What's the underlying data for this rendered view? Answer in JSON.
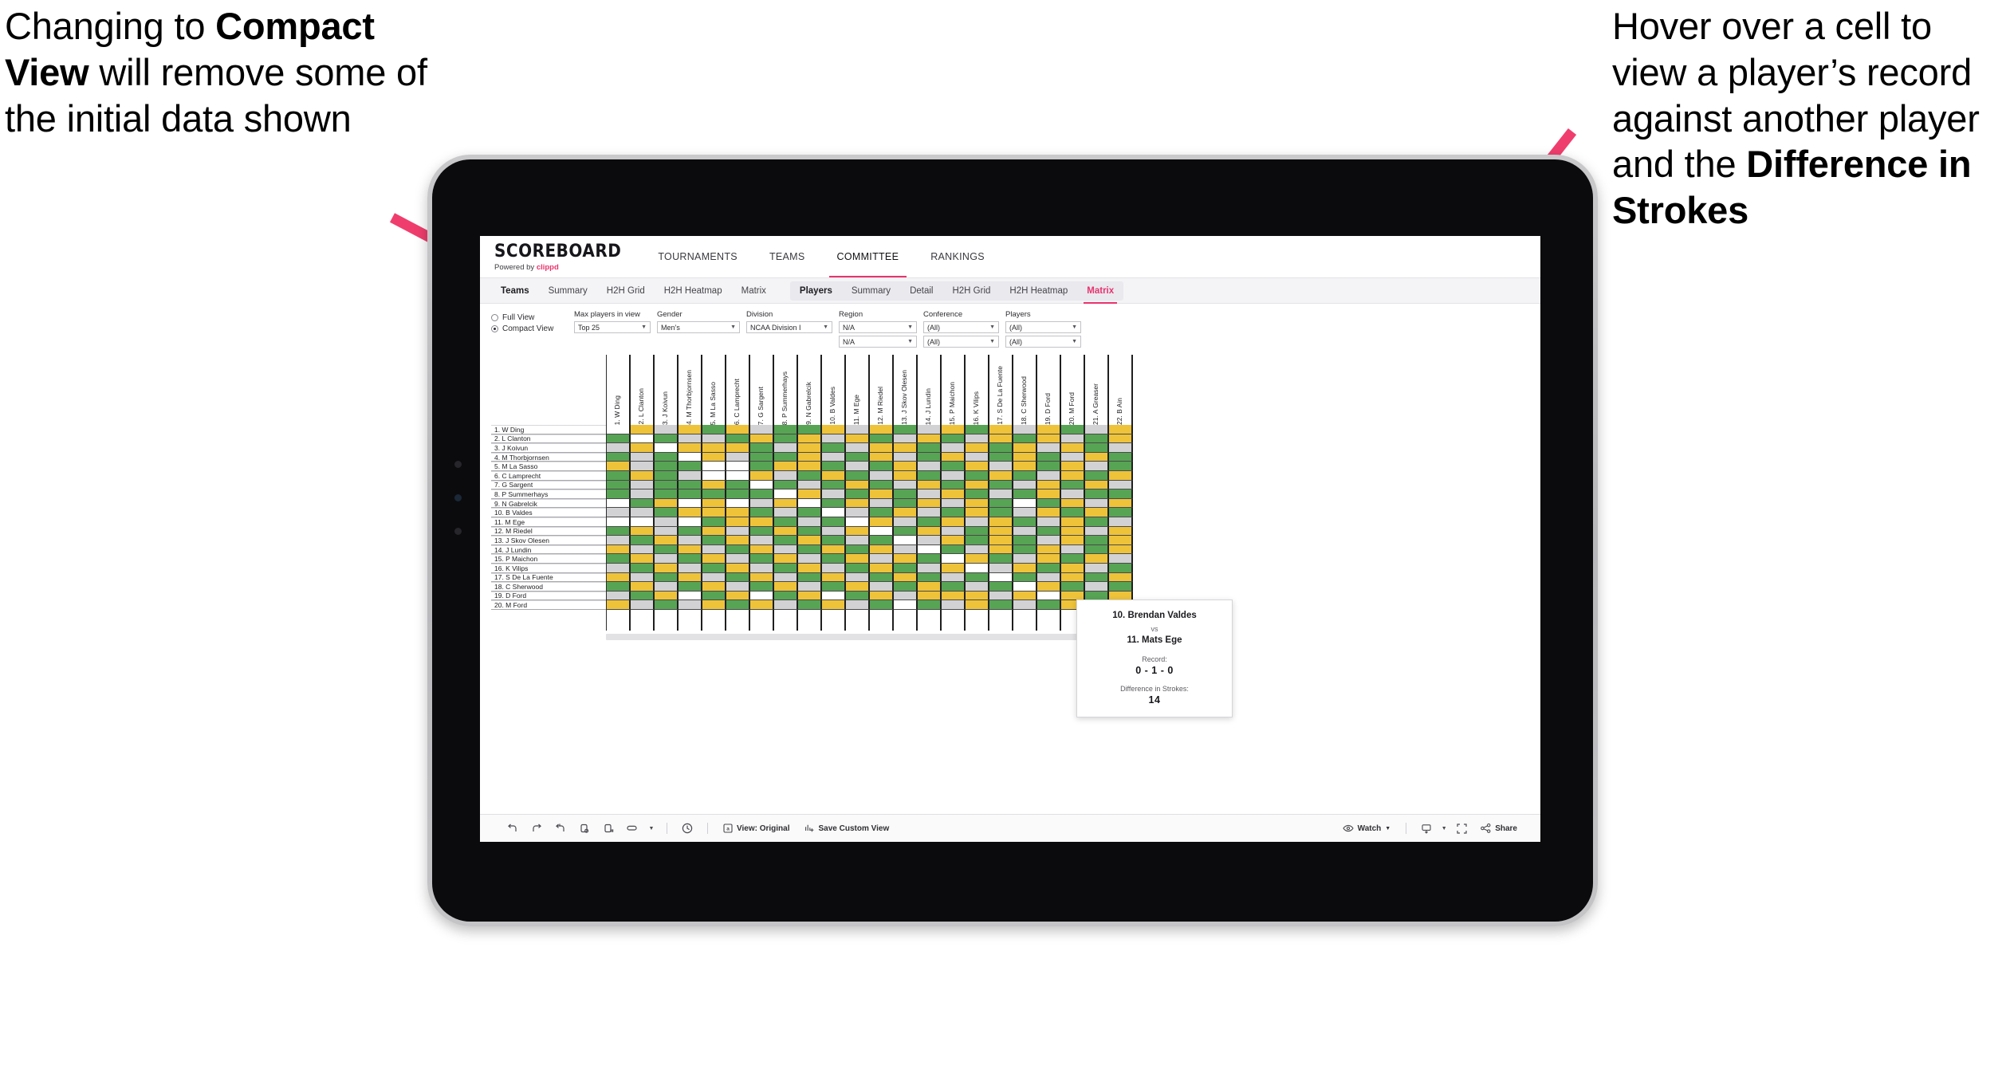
{
  "annotations": {
    "left": {
      "pre": "Changing to ",
      "bold": "Compact View",
      "post": " will remove some of the initial data shown"
    },
    "right": {
      "pre": "Hover over a cell to view a player’s record against another player and the ",
      "bold": "Difference in Strokes",
      "post": ""
    },
    "arrow_color": "#ef3e6d"
  },
  "app": {
    "brand": {
      "name": "SCOREBOARD",
      "powered_by": "Powered by",
      "vendor": "clippd"
    },
    "top_nav": [
      {
        "label": "TOURNAMENTS",
        "active": false
      },
      {
        "label": "TEAMS",
        "active": false
      },
      {
        "label": "COMMITTEE",
        "active": true
      },
      {
        "label": "RANKINGS",
        "active": false
      }
    ],
    "sub_nav_teams": [
      {
        "label": "Teams",
        "style": "bold"
      },
      {
        "label": "Summary",
        "style": "normal"
      },
      {
        "label": "H2H Grid",
        "style": "normal"
      },
      {
        "label": "H2H Heatmap",
        "style": "normal"
      },
      {
        "label": "Matrix",
        "style": "normal"
      }
    ],
    "sub_nav_players": [
      {
        "label": "Players",
        "style": "bold"
      },
      {
        "label": "Summary",
        "style": "normal"
      },
      {
        "label": "Detail",
        "style": "normal"
      },
      {
        "label": "H2H Grid",
        "style": "normal"
      },
      {
        "label": "H2H Heatmap",
        "style": "normal"
      },
      {
        "label": "Matrix",
        "style": "accent"
      }
    ],
    "view_toggle": {
      "full_view": "Full View",
      "compact_view": "Compact View",
      "selected": "Compact View"
    },
    "filters": [
      {
        "label": "Max players in view",
        "value": "Top 25",
        "value2": null,
        "width": "w1"
      },
      {
        "label": "Gender",
        "value": "Men’s",
        "value2": null,
        "width": "w2"
      },
      {
        "label": "Division",
        "value": "NCAA Division I",
        "value2": null,
        "width": "w3"
      },
      {
        "label": "Region",
        "value": "N/A",
        "value2": "N/A",
        "width": "w4"
      },
      {
        "label": "Conference",
        "value": "(All)",
        "value2": "(All)",
        "width": "w5"
      },
      {
        "label": "Players",
        "value": "(All)",
        "value2": "(All)",
        "width": "w6"
      }
    ],
    "bottom_toolbar": {
      "icons": [
        "undo-icon",
        "redo-icon",
        "revert-icon",
        "refresh-icon",
        "pause-icon",
        "highlight-icon",
        "chevron-down-icon"
      ],
      "clock_icon": "clock-icon",
      "view_original": "View: Original",
      "save_custom_view": "Save Custom View",
      "watch": "Watch",
      "download_icon": "download-icon",
      "fullscreen_icon": "fullscreen-icon",
      "share": "Share"
    },
    "tooltip": {
      "player_a": "10. Brendan Valdes",
      "vs": "vs",
      "player_b": "11. Mats Ege",
      "record_label": "Record:",
      "record_value": "0 - 1 - 0",
      "strokes_label": "Difference in Strokes:",
      "strokes_value": "14"
    }
  },
  "chart_data": {
    "type": "heatmap",
    "title": "Player Head-to-Head Matrix",
    "legend_colors": {
      "win": "#57a454",
      "tie": "#eec33a",
      "loss": "#d2d2d4",
      "none": "#ffffff"
    },
    "row_labels": [
      "1. W Ding",
      "2. L Clanton",
      "3. J Koivun",
      "4. M Thorbjornsen",
      "5. M La Sasso",
      "6. C Lamprecht",
      "7. G Sargent",
      "8. P Summerhays",
      "9. N Gabrelcik",
      "10. B Valdes",
      "11. M Ege",
      "12. M Riedel",
      "13. J Skov Olesen",
      "14. J Lundin",
      "15. P Maichon",
      "16. K Vilips",
      "17. S De La Fuente",
      "18. C Sherwood",
      "19. D Ford",
      "20. M Ford"
    ],
    "column_labels": [
      "1. W Ding",
      "2. L Clanton",
      "3. J Koivun",
      "4. M Thorbjornsen",
      "5. M La Sasso",
      "6. C Lamprecht",
      "7. G Sargent",
      "8. P Summerhays",
      "9. N Gabrelcik",
      "10. B Valdes",
      "11. M Ege",
      "12. M Riedel",
      "13. J Skov Olesen",
      "14. J Lundin",
      "15. P Maichon",
      "16. K Vilips",
      "17. S De La Fuente",
      "18. C Sherwood",
      "19. D Ford",
      "20. M Ford",
      "21. A Greaser",
      "22. B Ain"
    ],
    "cells": [
      [
        "w",
        "y",
        "s",
        "y",
        "g",
        "y",
        "s",
        "g",
        "g",
        "y",
        "s",
        "y",
        "g",
        "s",
        "y",
        "g",
        "y",
        "s",
        "y",
        "g",
        "s",
        "y"
      ],
      [
        "g",
        "w",
        "g",
        "s",
        "s",
        "g",
        "y",
        "g",
        "y",
        "s",
        "y",
        "g",
        "s",
        "y",
        "g",
        "s",
        "y",
        "g",
        "y",
        "s",
        "g",
        "y"
      ],
      [
        "s",
        "y",
        "w",
        "y",
        "y",
        "y",
        "g",
        "s",
        "y",
        "g",
        "s",
        "y",
        "y",
        "g",
        "s",
        "y",
        "g",
        "y",
        "s",
        "y",
        "g",
        "s"
      ],
      [
        "g",
        "s",
        "g",
        "w",
        "y",
        "s",
        "g",
        "g",
        "y",
        "s",
        "g",
        "y",
        "s",
        "g",
        "y",
        "s",
        "g",
        "y",
        "g",
        "s",
        "y",
        "g"
      ],
      [
        "y",
        "s",
        "g",
        "g",
        "w",
        "w",
        "g",
        "y",
        "y",
        "g",
        "s",
        "g",
        "y",
        "s",
        "g",
        "y",
        "s",
        "y",
        "g",
        "y",
        "s",
        "g"
      ],
      [
        "g",
        "y",
        "g",
        "s",
        "w",
        "w",
        "y",
        "s",
        "g",
        "y",
        "g",
        "s",
        "y",
        "g",
        "s",
        "g",
        "y",
        "g",
        "s",
        "y",
        "g",
        "y"
      ],
      [
        "g",
        "s",
        "g",
        "g",
        "y",
        "g",
        "w",
        "g",
        "s",
        "g",
        "y",
        "g",
        "s",
        "y",
        "g",
        "y",
        "g",
        "s",
        "y",
        "g",
        "y",
        "s"
      ],
      [
        "g",
        "s",
        "g",
        "g",
        "g",
        "g",
        "g",
        "w",
        "y",
        "s",
        "g",
        "y",
        "g",
        "s",
        "y",
        "g",
        "s",
        "g",
        "y",
        "s",
        "g",
        "g"
      ],
      [
        "w",
        "g",
        "y",
        "w",
        "y",
        "w",
        "s",
        "y",
        "w",
        "g",
        "y",
        "s",
        "g",
        "y",
        "s",
        "y",
        "g",
        "w",
        "g",
        "y",
        "s",
        "y"
      ],
      [
        "s",
        "s",
        "g",
        "y",
        "y",
        "y",
        "g",
        "s",
        "g",
        "w",
        "s",
        "g",
        "y",
        "s",
        "g",
        "y",
        "g",
        "s",
        "y",
        "g",
        "y",
        "g"
      ],
      [
        "w",
        "w",
        "s",
        "w",
        "g",
        "y",
        "y",
        "g",
        "s",
        "g",
        "w",
        "y",
        "s",
        "g",
        "y",
        "s",
        "y",
        "g",
        "s",
        "y",
        "g",
        "s"
      ],
      [
        "g",
        "y",
        "s",
        "g",
        "y",
        "s",
        "g",
        "y",
        "g",
        "s",
        "y",
        "w",
        "g",
        "y",
        "s",
        "g",
        "y",
        "s",
        "g",
        "y",
        "s",
        "y"
      ],
      [
        "s",
        "g",
        "y",
        "s",
        "g",
        "y",
        "s",
        "g",
        "y",
        "g",
        "s",
        "g",
        "w",
        "s",
        "y",
        "g",
        "y",
        "g",
        "s",
        "y",
        "g",
        "y"
      ],
      [
        "y",
        "s",
        "g",
        "y",
        "s",
        "g",
        "y",
        "s",
        "g",
        "y",
        "g",
        "y",
        "s",
        "w",
        "g",
        "s",
        "y",
        "g",
        "y",
        "s",
        "g",
        "y"
      ],
      [
        "g",
        "y",
        "s",
        "g",
        "y",
        "s",
        "g",
        "y",
        "s",
        "g",
        "y",
        "s",
        "y",
        "g",
        "w",
        "y",
        "g",
        "s",
        "y",
        "g",
        "y",
        "s"
      ],
      [
        "s",
        "g",
        "y",
        "s",
        "g",
        "y",
        "s",
        "g",
        "y",
        "s",
        "g",
        "y",
        "g",
        "s",
        "y",
        "w",
        "s",
        "y",
        "g",
        "y",
        "s",
        "g"
      ],
      [
        "y",
        "s",
        "g",
        "y",
        "s",
        "g",
        "y",
        "s",
        "g",
        "y",
        "s",
        "g",
        "y",
        "g",
        "s",
        "g",
        "w",
        "g",
        "s",
        "y",
        "g",
        "y"
      ],
      [
        "g",
        "y",
        "s",
        "g",
        "y",
        "s",
        "g",
        "y",
        "s",
        "g",
        "y",
        "s",
        "g",
        "y",
        "g",
        "s",
        "g",
        "w",
        "y",
        "g",
        "s",
        "g"
      ],
      [
        "s",
        "g",
        "y",
        "w",
        "g",
        "y",
        "w",
        "g",
        "y",
        "w",
        "g",
        "y",
        "s",
        "y",
        "y",
        "y",
        "s",
        "y",
        "w",
        "y",
        "g",
        "y"
      ],
      [
        "y",
        "s",
        "g",
        "s",
        "y",
        "g",
        "y",
        "s",
        "g",
        "y",
        "s",
        "g",
        "w",
        "g",
        "s",
        "y",
        "g",
        "s",
        "g",
        "y",
        "g",
        "g"
      ]
    ]
  }
}
